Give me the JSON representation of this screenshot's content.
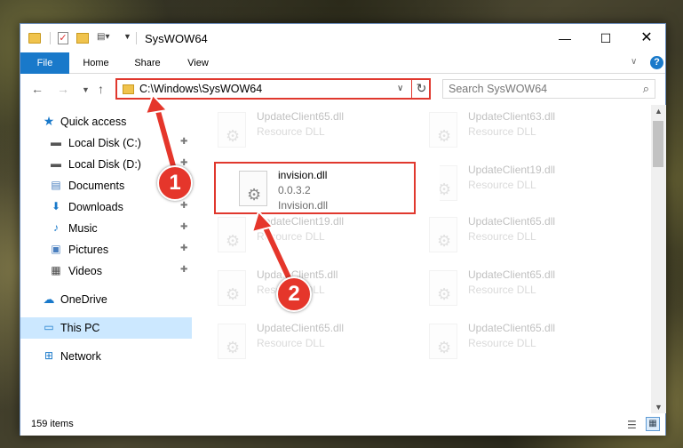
{
  "window": {
    "title": "SysWOW64",
    "min_glyph": "—",
    "max_glyph": "☐",
    "close_glyph": "✕"
  },
  "ribbon": {
    "tabs": [
      "File",
      "Home",
      "Share",
      "View"
    ]
  },
  "navigation": {
    "address": "C:\\Windows\\SysWOW64",
    "search_placeholder": "Search SysWOW64"
  },
  "sidebar": {
    "items": [
      {
        "label": "Quick access",
        "icon": "star-icon",
        "pinned": false
      },
      {
        "label": "Local Disk (C:)",
        "icon": "drive-icon",
        "pinned": true
      },
      {
        "label": "Local Disk (D:)",
        "icon": "drive-icon",
        "pinned": true
      },
      {
        "label": "Documents",
        "icon": "documents-icon",
        "pinned": true
      },
      {
        "label": "Downloads",
        "icon": "download-icon",
        "pinned": true
      },
      {
        "label": "Music",
        "icon": "music-icon",
        "pinned": true
      },
      {
        "label": "Pictures",
        "icon": "pictures-icon",
        "pinned": true
      },
      {
        "label": "Videos",
        "icon": "videos-icon",
        "pinned": true
      },
      {
        "label": "OneDrive",
        "icon": "cloud-icon",
        "pinned": false
      },
      {
        "label": "This PC",
        "icon": "computer-icon",
        "pinned": false,
        "selected": true
      },
      {
        "label": "Network",
        "icon": "network-icon",
        "pinned": false
      }
    ]
  },
  "files": {
    "highlighted": {
      "name": "invision.dll",
      "version": "0.0.3.2",
      "description": "Invision.dll"
    },
    "background": [
      {
        "name": "UpdateClient65.dll",
        "type": "Resource DLL"
      },
      {
        "name": "UpdateClient63.dll",
        "type": "Resource DLL"
      },
      {
        "name": "UpdateClient19.dll",
        "type": "Resource DLL"
      },
      {
        "name": "UpdateClient19.dll",
        "type": "Resource DLL"
      },
      {
        "name": "UpdateClient65.dll",
        "type": "Resource DLL"
      },
      {
        "name": "UpdateClient5.dll",
        "type": "Resource DLL"
      },
      {
        "name": "UpdateClient65.dll",
        "type": "Resource DLL"
      },
      {
        "name": "UpdateClient65.dll",
        "type": "Resource DLL"
      },
      {
        "name": "UpdateClient65.dll",
        "type": "Resource DLL"
      }
    ]
  },
  "status": {
    "item_count": "159 items"
  },
  "annotations": {
    "step1": "1",
    "step2": "2",
    "color": "#e5362b"
  }
}
